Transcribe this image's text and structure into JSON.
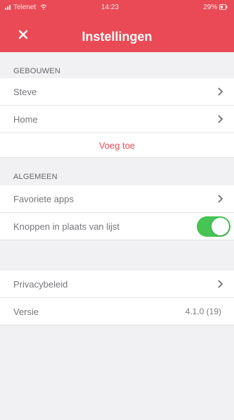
{
  "status_bar": {
    "carrier": "Telenet",
    "time": "14:23",
    "battery": "29%"
  },
  "header": {
    "title": "Instellingen",
    "close_icon": "close-icon"
  },
  "sections": {
    "gebouwen": "GEBOUWEN",
    "algemeen": "ALGEMEEN"
  },
  "gebouwen_items": [
    {
      "label": "Steve"
    },
    {
      "label": "Home"
    }
  ],
  "add_label": "Voeg toe",
  "algemeen_items": {
    "favoriete": "Favoriete apps",
    "knoppen": "Knoppen in plaats van lijst",
    "knoppen_enabled": true
  },
  "other_items": {
    "privacy": "Privacybeleid",
    "versie_label": "Versie",
    "versie_value": "4.1.0 (19)"
  },
  "colors": {
    "accent": "#e94a55",
    "toggle_on": "#47c454"
  }
}
